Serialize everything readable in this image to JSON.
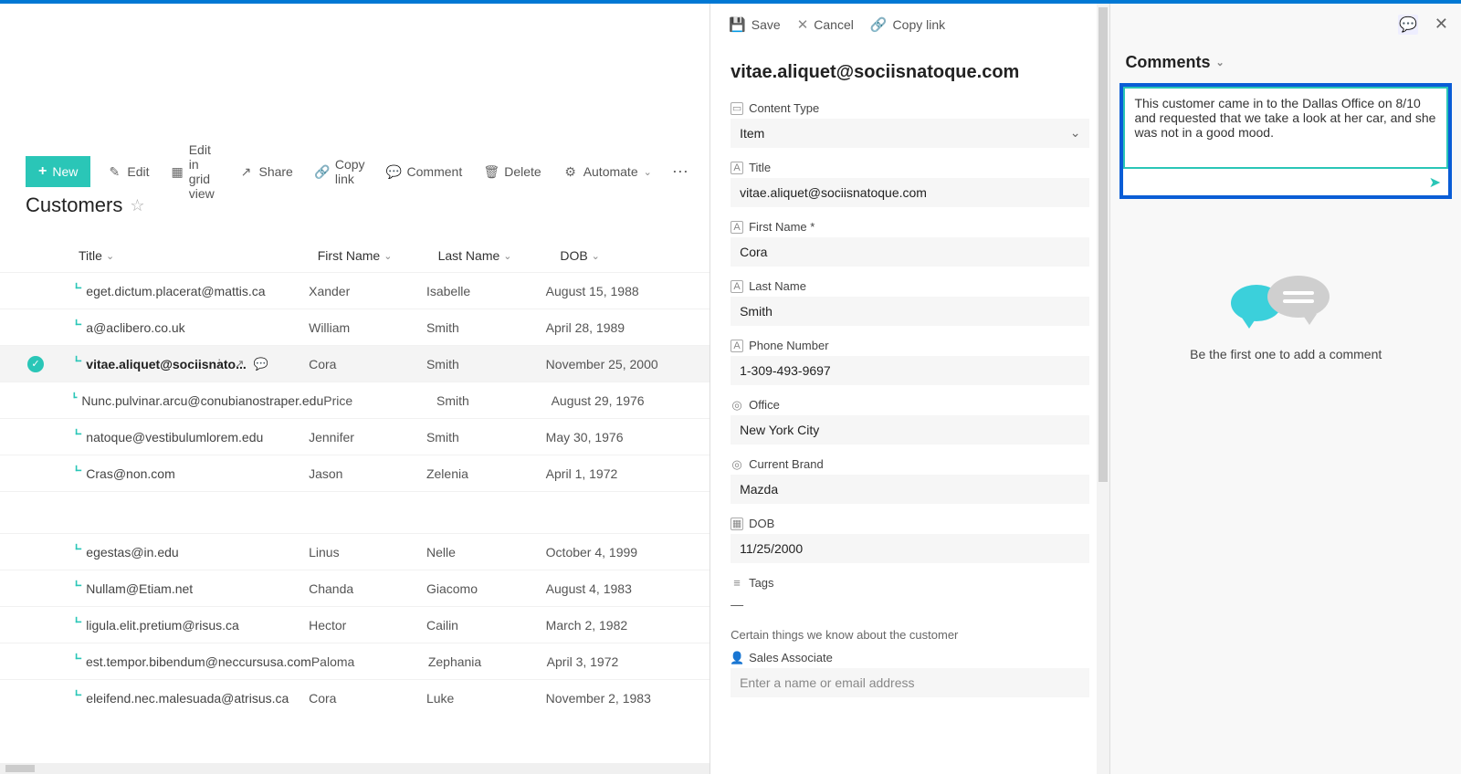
{
  "toolbar": {
    "new_label": "New",
    "edit_label": "Edit",
    "grid_label": "Edit in grid view",
    "share_label": "Share",
    "copylink_label": "Copy link",
    "comment_label": "Comment",
    "delete_label": "Delete",
    "automate_label": "Automate"
  },
  "list": {
    "title": "Customers",
    "columns": {
      "title": "Title",
      "first_name": "First Name",
      "last_name": "Last Name",
      "dob": "DOB"
    },
    "rows": [
      {
        "title": "eget.dictum.placerat@mattis.ca",
        "first": "Xander",
        "last": "Isabelle",
        "dob": "August 15, 1988"
      },
      {
        "title": "a@aclibero.co.uk",
        "first": "William",
        "last": "Smith",
        "dob": "April 28, 1989"
      },
      {
        "title": "vitae.aliquet@sociisnato...",
        "first": "Cora",
        "last": "Smith",
        "dob": "November 25, 2000",
        "selected": true
      },
      {
        "title": "Nunc.pulvinar.arcu@conubianostraper.edu",
        "first": "Price",
        "last": "Smith",
        "dob": "August 29, 1976"
      },
      {
        "title": "natoque@vestibulumlorem.edu",
        "first": "Jennifer",
        "last": "Smith",
        "dob": "May 30, 1976"
      },
      {
        "title": "Cras@non.com",
        "first": "Jason",
        "last": "Zelenia",
        "dob": "April 1, 1972"
      },
      {
        "title": "egestas@in.edu",
        "first": "Linus",
        "last": "Nelle",
        "dob": "October 4, 1999"
      },
      {
        "title": "Nullam@Etiam.net",
        "first": "Chanda",
        "last": "Giacomo",
        "dob": "August 4, 1983"
      },
      {
        "title": "ligula.elit.pretium@risus.ca",
        "first": "Hector",
        "last": "Cailin",
        "dob": "March 2, 1982"
      },
      {
        "title": "est.tempor.bibendum@neccursusa.com",
        "first": "Paloma",
        "last": "Zephania",
        "dob": "April 3, 1972"
      },
      {
        "title": "eleifend.nec.malesuada@atrisus.ca",
        "first": "Cora",
        "last": "Luke",
        "dob": "November 2, 1983"
      }
    ]
  },
  "detail": {
    "actions": {
      "save": "Save",
      "cancel": "Cancel",
      "copylink": "Copy link"
    },
    "title": "vitae.aliquet@sociisnatoque.com",
    "fields": {
      "content_type": {
        "label": "Content Type",
        "value": "Item"
      },
      "title": {
        "label": "Title",
        "value": "vitae.aliquet@sociisnatoque.com"
      },
      "first_name": {
        "label": "First Name *",
        "value": "Cora"
      },
      "last_name": {
        "label": "Last Name",
        "value": "Smith"
      },
      "phone": {
        "label": "Phone Number",
        "value": "1-309-493-9697"
      },
      "office": {
        "label": "Office",
        "value": "New York City"
      },
      "brand": {
        "label": "Current Brand",
        "value": "Mazda"
      },
      "dob": {
        "label": "DOB",
        "value": "11/25/2000"
      },
      "tags": {
        "label": "Tags",
        "value": "—"
      },
      "sales_assoc": {
        "label": "Sales Associate",
        "placeholder": "Enter a name or email address"
      }
    },
    "section_note": "Certain things we know about the customer"
  },
  "comments": {
    "header": "Comments",
    "input_value": "This customer came in to the Dallas Office on 8/10 and requested that we take a look at her car, and she was not in a good mood.",
    "empty_text": "Be the first one to add a comment"
  }
}
